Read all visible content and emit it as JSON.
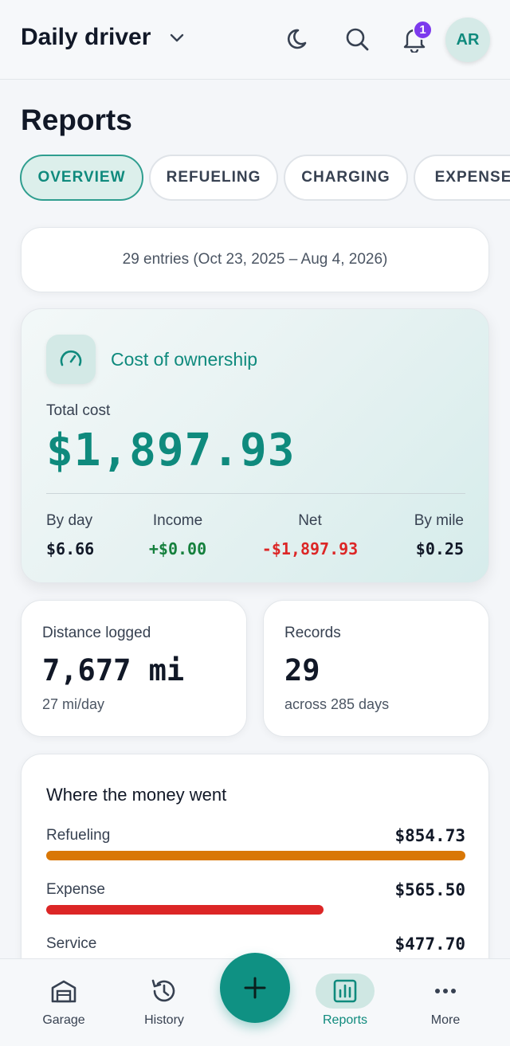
{
  "header": {
    "vehicle_name": "Daily driver",
    "notification_count": "1",
    "avatar_initials": "AR"
  },
  "page": {
    "title": "Reports"
  },
  "tabs": [
    {
      "label": "OVERVIEW",
      "active": true
    },
    {
      "label": "REFUELING",
      "active": false
    },
    {
      "label": "CHARGING",
      "active": false
    },
    {
      "label": "EXPENSE",
      "active": false
    }
  ],
  "range": {
    "text": "29 entries (Oct 23, 2025 – Aug 4, 2026)"
  },
  "cost": {
    "title": "Cost of ownership",
    "total_label": "Total cost",
    "total_value": "$1,897.93",
    "stats": [
      {
        "label": "By day",
        "value": "$6.66",
        "color": "#111827"
      },
      {
        "label": "Income",
        "value": "+$0.00",
        "color": "#15803d"
      },
      {
        "label": "Net",
        "value": "-$1,897.93",
        "color": "#dc2626"
      },
      {
        "label": "By mile",
        "value": "$0.25",
        "color": "#111827"
      }
    ]
  },
  "distance": {
    "label": "Distance logged",
    "value": "7,677 mi",
    "sub": "27 mi/day"
  },
  "records": {
    "label": "Records",
    "value": "29",
    "sub": "across 285 days"
  },
  "money": {
    "title": "Where the money went",
    "items": [
      {
        "label": "Refueling",
        "value": "$854.73",
        "fraction": 1.0,
        "color": "#d97706"
      },
      {
        "label": "Expense",
        "value": "$565.50",
        "fraction": 0.662,
        "color": "#dc2626"
      },
      {
        "label": "Service",
        "value": "$477.70",
        "fraction": 0.559,
        "color": "#cfe7e3"
      }
    ]
  },
  "nav": [
    {
      "label": "Garage",
      "icon": "garage-icon",
      "active": false
    },
    {
      "label": "History",
      "icon": "history-icon",
      "active": false
    },
    {
      "label": "Reports",
      "icon": "reports-icon",
      "active": true
    },
    {
      "label": "More",
      "icon": "more-icon",
      "active": false
    }
  ],
  "colors": {
    "accent": "#0f8a7d",
    "badge": "#7c3aed"
  }
}
